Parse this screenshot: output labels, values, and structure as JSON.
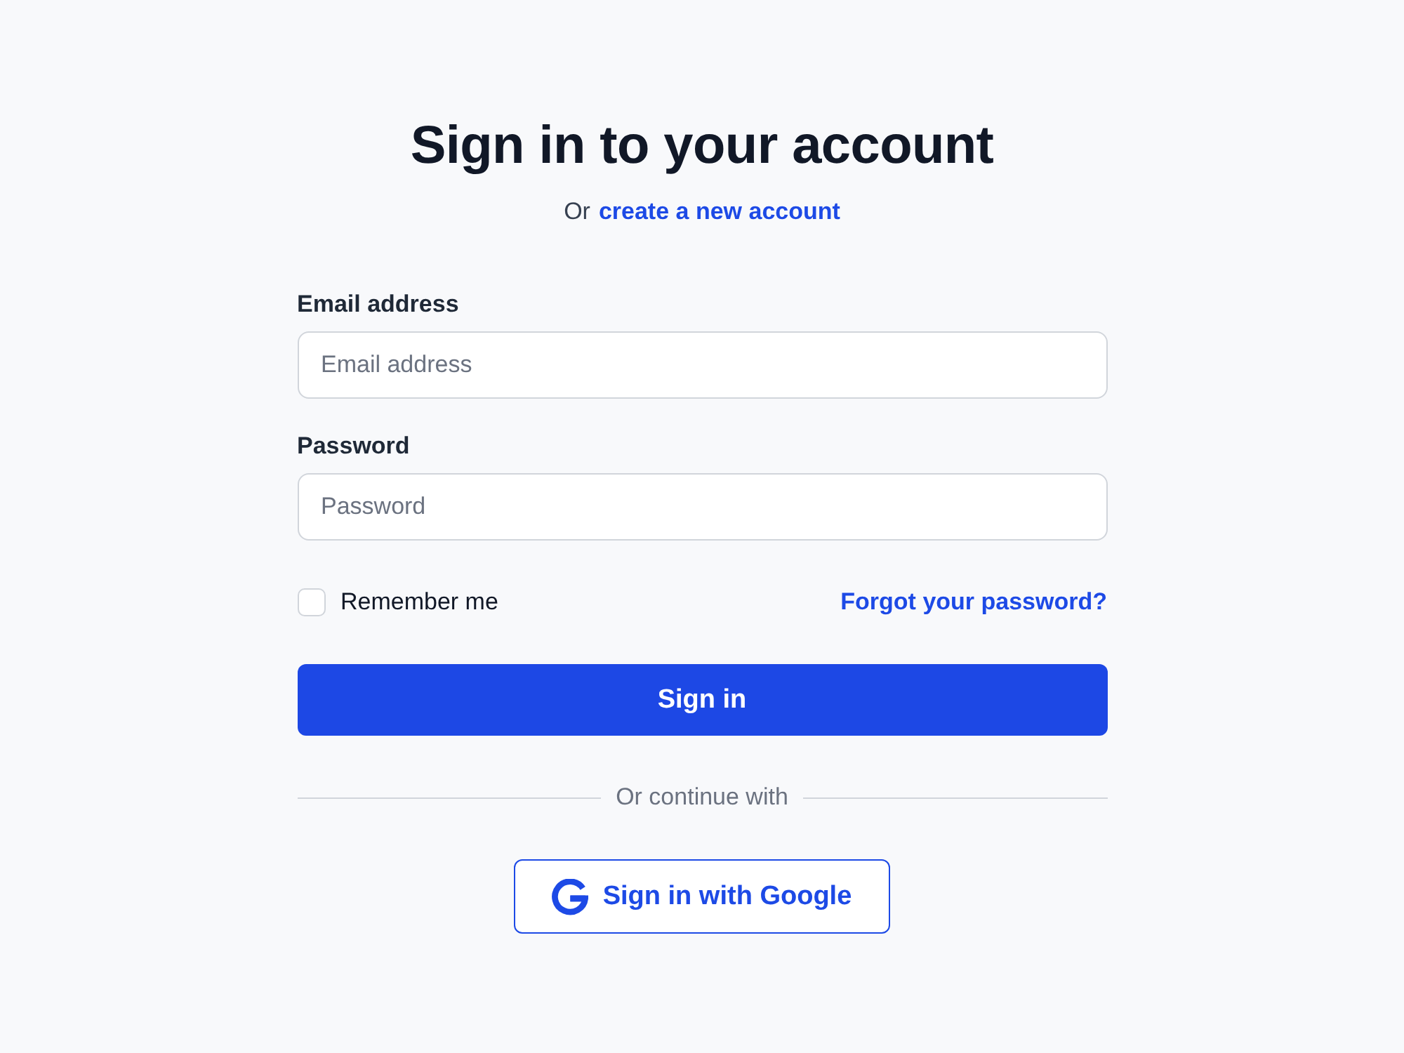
{
  "heading": {
    "title": "Sign in to your account",
    "prompt": "Or",
    "link": "create a new account"
  },
  "fields": [
    {
      "label": "Email address",
      "placeholder": "Email address"
    },
    {
      "label": "Password",
      "placeholder": "Password"
    }
  ],
  "remember": {
    "label": "Remember me",
    "checked": false
  },
  "forgot_link": "Forgot your password?",
  "submit": "Sign in",
  "divider": "Or continue with",
  "social_button": {
    "label": "Sign in with Google"
  }
}
